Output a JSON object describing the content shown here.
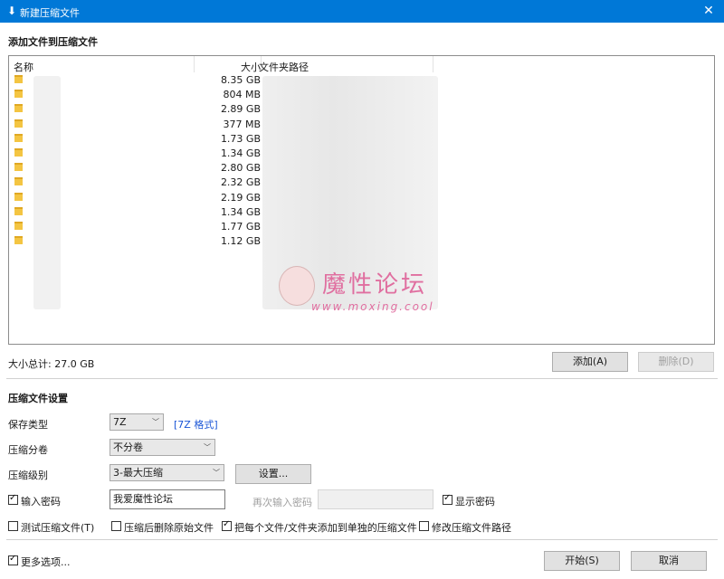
{
  "window": {
    "title": "新建压缩文件",
    "close_glyph": "✕"
  },
  "files_section": {
    "title": "添加文件到压缩文件"
  },
  "columns": {
    "name": "名称",
    "size": "大小",
    "path": "文件夹路径"
  },
  "rows": [
    {
      "size": "8.35 GB"
    },
    {
      "size": "804 MB"
    },
    {
      "size": "2.89 GB"
    },
    {
      "size": "377 MB"
    },
    {
      "size": "1.73 GB"
    },
    {
      "size": "1.34 GB"
    },
    {
      "size": "2.80 GB"
    },
    {
      "size": "2.32 GB"
    },
    {
      "size": "2.19 GB"
    },
    {
      "size": "1.34 GB"
    },
    {
      "size": "1.77 GB"
    },
    {
      "size": "1.12 GB"
    }
  ],
  "watermark": {
    "title": "魔性论坛",
    "url": "www.moxing.cool"
  },
  "total": "大小总计: 27.0 GB",
  "buttons": {
    "add": "添加(A)",
    "delete": "删除(D)",
    "settings": "设置...",
    "start": "开始(S)",
    "cancel": "取消"
  },
  "settings_section": {
    "title": "压缩文件设置"
  },
  "fields": {
    "save_type": {
      "label": "保存类型",
      "value": "7Z",
      "format_link": "[7Z 格式]"
    },
    "split": {
      "label": "压缩分卷",
      "value": "不分卷"
    },
    "level": {
      "label": "压缩级别",
      "value": "3-最大压缩"
    }
  },
  "password": {
    "label": "输入密码",
    "value": "我爱魔性论坛",
    "confirm_label": "再次输入密码",
    "show_label": "显示密码"
  },
  "options": {
    "test": "测试压缩文件(T)",
    "delete_source": "压缩后删除原始文件",
    "separate": "把每个文件/文件夹添加到单独的压缩文件",
    "modify_path": "修改压缩文件路径",
    "more": "更多选项..."
  },
  "colors": {
    "titlebar": "#0078d7",
    "link": "#1a55d6",
    "watermark": "#e06fa0"
  }
}
